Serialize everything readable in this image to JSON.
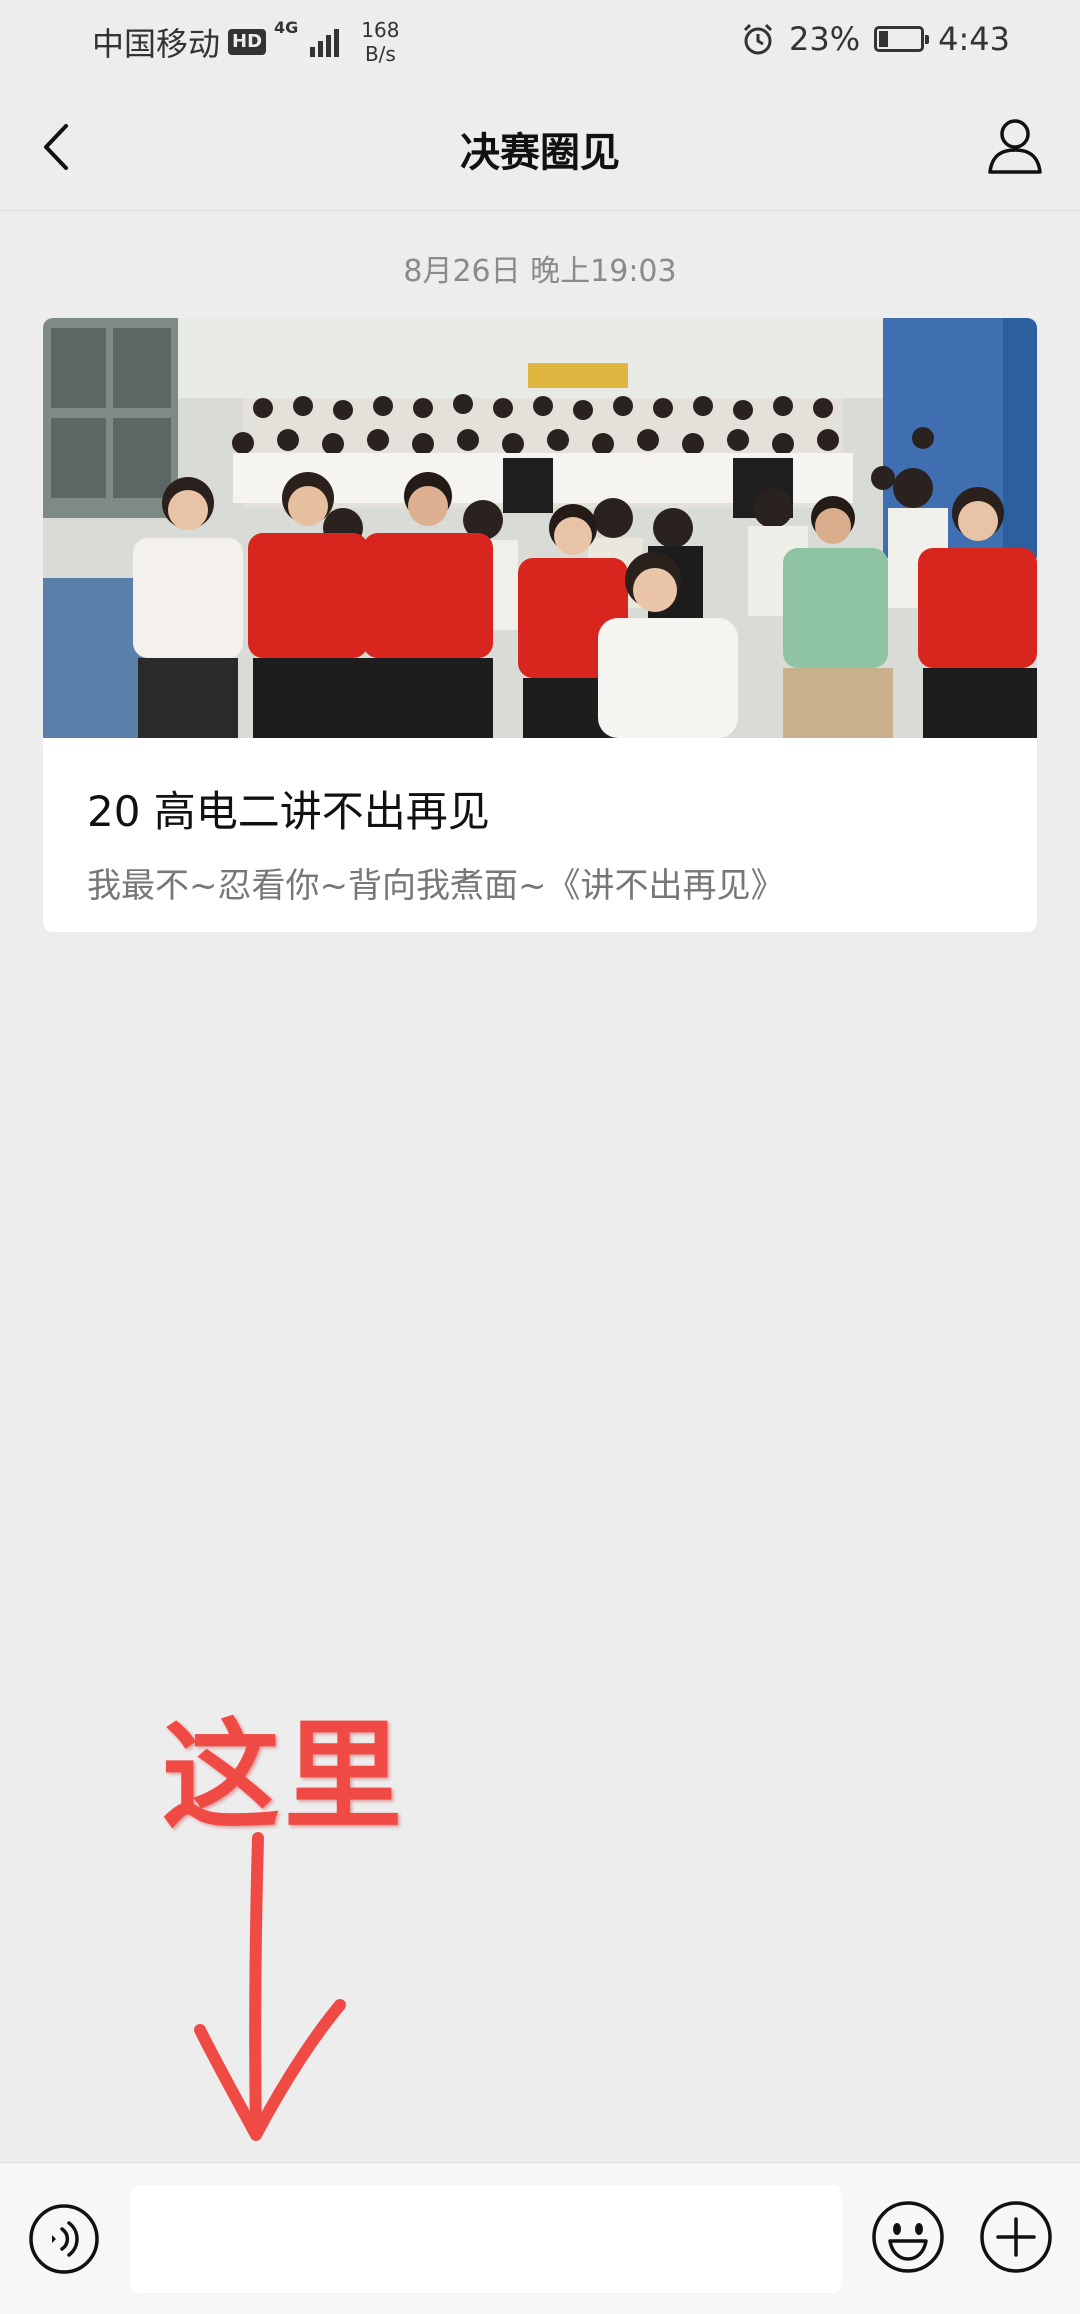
{
  "status_bar": {
    "carrier": "中国移动",
    "hd": "HD",
    "network": "4G",
    "speed_value": "168",
    "speed_unit": "B/s",
    "battery": "23%",
    "battery_level": 0.23,
    "time": "4:43"
  },
  "nav": {
    "title": "决赛圈见",
    "back_icon": "chevron-left-icon",
    "profile_icon": "person-icon"
  },
  "timestamp": "8月26日 晚上19:03",
  "card": {
    "title": "20 高电二讲不出再见",
    "subtitle": "我最不~忍看你~背向我煮面~《讲不出再见》"
  },
  "annotation": {
    "text": "这里",
    "color": "#f04a45"
  },
  "input_bar": {
    "voice_icon": "voice-icon",
    "input_value": "",
    "emoji_icon": "emoji-icon",
    "plus_icon": "plus-icon"
  }
}
